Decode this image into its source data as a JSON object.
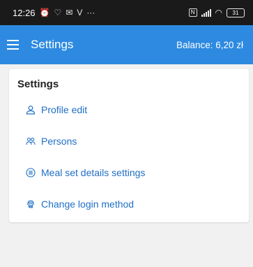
{
  "status_bar": {
    "time": "12:26",
    "battery": "31"
  },
  "app_bar": {
    "title": "Settings",
    "balance": "Balance: 6,20 zł"
  },
  "card": {
    "title": "Settings",
    "items": [
      {
        "label": "Profile edit",
        "icon": "person-icon"
      },
      {
        "label": "Persons",
        "icon": "people-icon"
      },
      {
        "label": "Meal set details settings",
        "icon": "list-icon"
      },
      {
        "label": "Change login method",
        "icon": "fingerprint-icon"
      }
    ]
  },
  "colors": {
    "accent": "#2d8ae0",
    "link": "#1f6fc6",
    "background": "#f1f1f1"
  }
}
